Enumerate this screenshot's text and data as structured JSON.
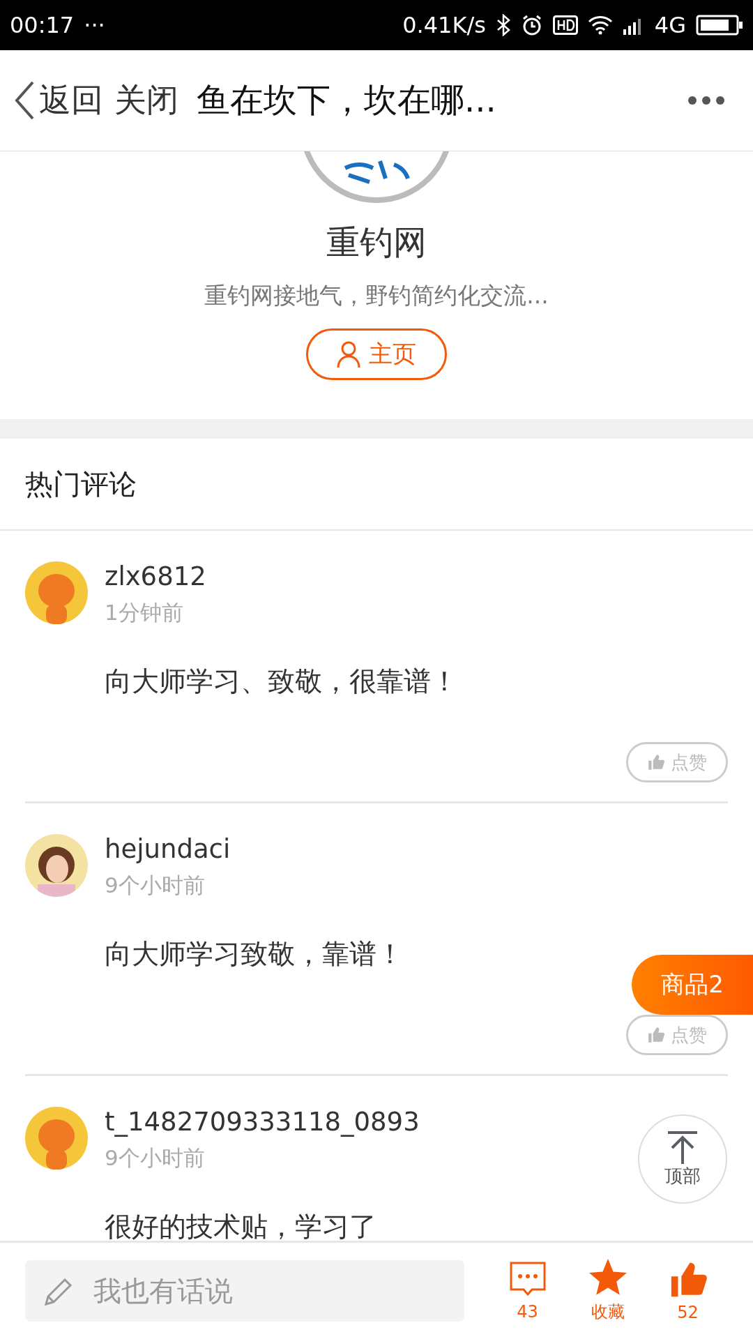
{
  "status_bar": {
    "time": "00:17",
    "more": "···",
    "speed": "0.41K/s",
    "network": "4G"
  },
  "nav": {
    "back": "返回",
    "close": "关闭",
    "title": "鱼在坎下，坎在哪..."
  },
  "profile": {
    "name": "重钓网",
    "description": "重钓网接地气，野钓简约化交流...",
    "home_button": "主页"
  },
  "section_title": "热门评论",
  "comments": [
    {
      "user": "zlx6812",
      "time": "1分钟前",
      "text": "向大师学习、致敬，很靠谱！",
      "kind": "cartoon",
      "like": "点赞"
    },
    {
      "user": "hejundaci",
      "time": "9个小时前",
      "text": "向大师学习致敬，靠谱！",
      "kind": "photo",
      "like": "点赞"
    },
    {
      "user": "t_1482709333118_0893",
      "time": "9个小时前",
      "text": "很好的技术贴，学习了",
      "kind": "cartoon"
    }
  ],
  "floating": {
    "goods": "商品2",
    "top": "顶部"
  },
  "bottom_bar": {
    "placeholder": "我也有话说",
    "comments": "43",
    "favorite": "收藏",
    "likes": "52"
  }
}
